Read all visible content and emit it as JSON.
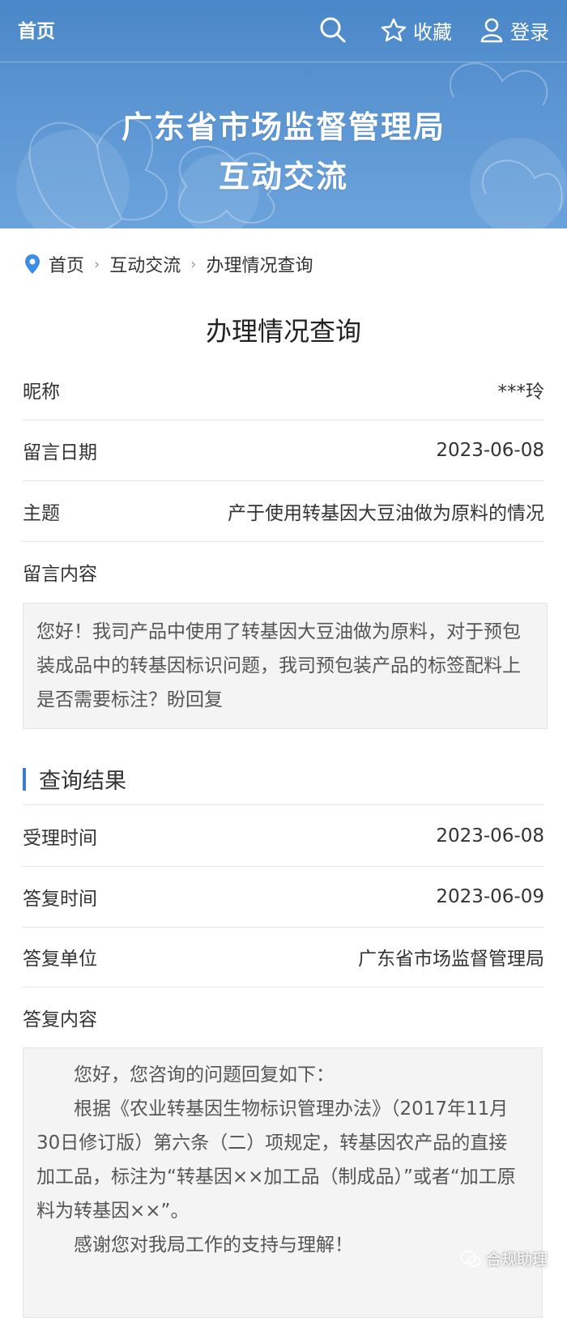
{
  "topbar": {
    "home": "首页",
    "favorite": "收藏",
    "login": "登录"
  },
  "banner": {
    "line1": "广东省市场监督管理局",
    "line2": "互动交流"
  },
  "breadcrumb": [
    "首页",
    "互动交流",
    "办理情况查询"
  ],
  "page_title": "办理情况查询",
  "message": {
    "nickname_label": "昵称",
    "nickname": "***玲",
    "date_label": "留言日期",
    "date": "2023-06-08",
    "subject_label": "主题",
    "subject": "产于使用转基因大豆油做为原料的情况",
    "content_label": "留言内容",
    "content": "您好！我司产品中使用了转基因大豆油做为原料，对于预包装成品中的转基因标识问题，我司预包装产品的标签配料上是否需要标注？盼回复"
  },
  "result": {
    "section_title": "查询结果",
    "accept_time_label": "受理时间",
    "accept_time": "2023-06-08",
    "reply_time_label": "答复时间",
    "reply_time": "2023-06-09",
    "reply_unit_label": "答复单位",
    "reply_unit": "广东省市场监督管理局",
    "reply_content_label": "答复内容",
    "reply_lines": [
      "您好，您咨询的问题回复如下：",
      "根据《农业转基因生物标识管理办法》（2017年11月30日修订版）第六条（二）项规定，转基因农产品的直接加工品，标注为“转基因××加工品（制成品）”或者“加工原料为转基因××”。",
      "感谢您对我局工作的支持与理解！"
    ]
  },
  "watermark": "合规助理",
  "colors": {
    "banner": "#5b95d2",
    "accent": "#3b7ed0",
    "box_bg": "#f4f4f4"
  }
}
